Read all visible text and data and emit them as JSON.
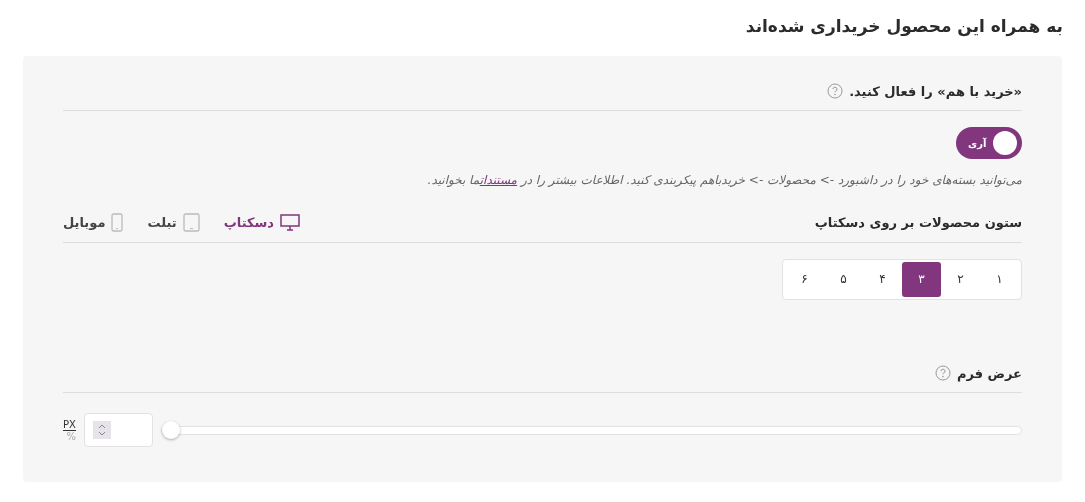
{
  "page_title": "به همراه این محصول خریداری شده‌اند",
  "bundle": {
    "title": "«خرید با هم» را فعال کنید.",
    "toggle": {
      "label": "آری",
      "on": true
    },
    "help": {
      "before": "می‌توانید بسته‌های خود را در داشبورد -> محصولات -> خریدباهم پیکربندی کنید. اطلاعات بیشتر را در ",
      "link": "مستندات",
      "after": "ما بخوانید."
    }
  },
  "columns": {
    "title": "ستون محصولات بر روی دسکتاپ",
    "devices": [
      {
        "kind": "desktop",
        "label": "دسکتاپ",
        "selected": true
      },
      {
        "kind": "tablet",
        "label": "تبلت",
        "selected": false
      },
      {
        "kind": "mobile",
        "label": "موبایل",
        "selected": false
      }
    ],
    "options": [
      {
        "label": "۱",
        "selected": false
      },
      {
        "label": "۲",
        "selected": false
      },
      {
        "label": "۳",
        "selected": true
      },
      {
        "label": "۴",
        "selected": false
      },
      {
        "label": "۵",
        "selected": false
      },
      {
        "label": "۶",
        "selected": false
      }
    ]
  },
  "form_width": {
    "title": "عرض فرم",
    "level": 0,
    "units": [
      {
        "label": "PX",
        "selected": true
      },
      {
        "label": "%",
        "selected": false
      }
    ]
  }
}
